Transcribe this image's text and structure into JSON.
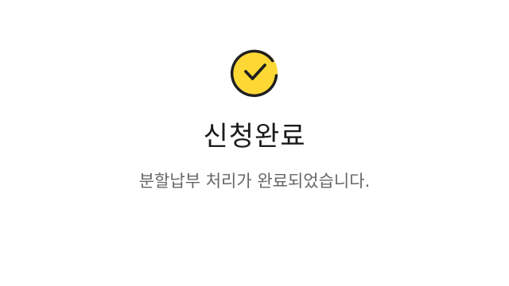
{
  "result": {
    "icon": "check-circle-icon",
    "title": "신청완료",
    "message": "분할납부 처리가 완료되었습니다."
  },
  "colors": {
    "accent": "#FDD835",
    "outline": "#1F1F1F",
    "title": "#1A1A1A",
    "message": "#666666",
    "background": "#FFFFFF"
  }
}
